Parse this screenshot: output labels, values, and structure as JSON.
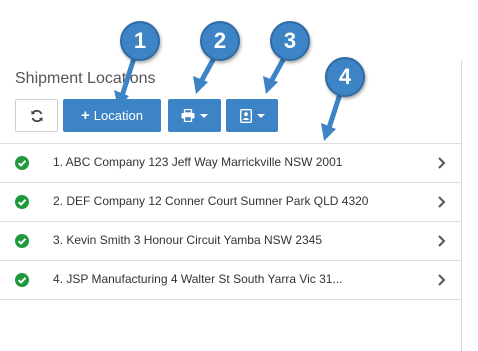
{
  "section": {
    "title": "Shipment Locations"
  },
  "toolbar": {
    "refresh_icon": "refresh-icon",
    "location_label": "Location",
    "location_icon": "plus-icon",
    "print_icon": "printer-icon",
    "contact_icon": "contact-card-icon"
  },
  "locations": [
    {
      "text": "1. ABC Company 123 Jeff Way Marrickville NSW 2001",
      "status": "complete"
    },
    {
      "text": "2. DEF Company 12 Conner Court Sumner Park QLD 4320",
      "status": "complete"
    },
    {
      "text": "3. Kevin Smith 3 Honour Circuit Yamba NSW 2345",
      "status": "complete"
    },
    {
      "text": "4. JSP Manufacturing 4 Walter St South Yarra Vic 31...",
      "status": "complete"
    }
  ],
  "callouts": [
    "1",
    "2",
    "3",
    "4"
  ],
  "colors": {
    "primary": "#3d84c6",
    "success": "#1e9a3a",
    "border": "#dedede"
  }
}
